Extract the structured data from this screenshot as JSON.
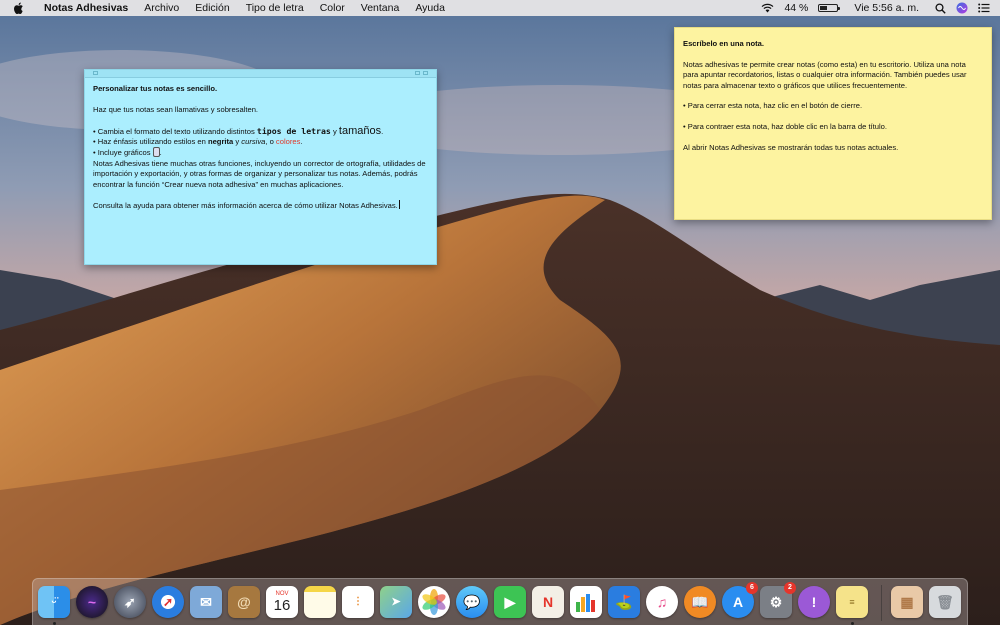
{
  "menubar": {
    "app_name": "Notas Adhesivas",
    "menus": [
      "Archivo",
      "Edición",
      "Tipo de letra",
      "Color",
      "Ventana",
      "Ayuda"
    ],
    "battery": "44 %",
    "battery_level": 0.44,
    "clock": "Vie 5:56 a. m."
  },
  "note_blue": {
    "heading": "Personalizar tus notas es sencillo.",
    "intro": "Haz que tus notas sean llamativas y sobresalten.",
    "b1_prefix": "• Cambia el formato del texto utilizando distintos ",
    "b1_mono": "tipos de letras",
    "b1_mid": " y ",
    "b1_big": "tamaños",
    "b1_end": ".",
    "b2_prefix": "• Haz énfasis utilizando estilos en ",
    "b2_bold": "negrita",
    "b2_mid": " y ",
    "b2_italic": "cursiva",
    "b2_mid2": ", o ",
    "b2_colored": "colores",
    "b2_end": ".",
    "b3_prefix": "• Incluye gráficos ",
    "b3_end": ".",
    "para1": "Notas Adhesivas tiene muchas otras funciones, incluyendo un corrector de ortografía, utilidades de importación y exportación, y otras formas de organizar y personalizar tus notas. Además, podrás encontrar la función “Crear nueva nota adhesiva” en muchas aplicaciones.",
    "para2": "Consulta la ayuda para obtener más información acerca de cómo utilizar Notas Adhesivas."
  },
  "note_yellow": {
    "heading": "Escríbelo en una nota.",
    "para1": "Notas adhesivas te permite crear notas (como esta) en tu escritorio. Utiliza una nota para apuntar recordatorios, listas o cualquier otra información. También puedes usar notas para almacenar texto o gráficos que utilices frecuentemente.",
    "bullet1": "• Para cerrar esta nota, haz clic en el botón de cierre.",
    "bullet2": "• Para contraer esta nota, haz doble clic en la barra de título.",
    "para2": "Al abrir Notas Adhesivas se mostrarán todas tus notas actuales."
  },
  "dock": {
    "calendar_month": "NOV",
    "calendar_day": "16",
    "app_store_badge": "6",
    "system_prefs_badge": "2"
  },
  "colors": {
    "note_blue": "#abeefe",
    "note_yellow": "#fdf3a0",
    "badge_red": "#e5352b"
  }
}
